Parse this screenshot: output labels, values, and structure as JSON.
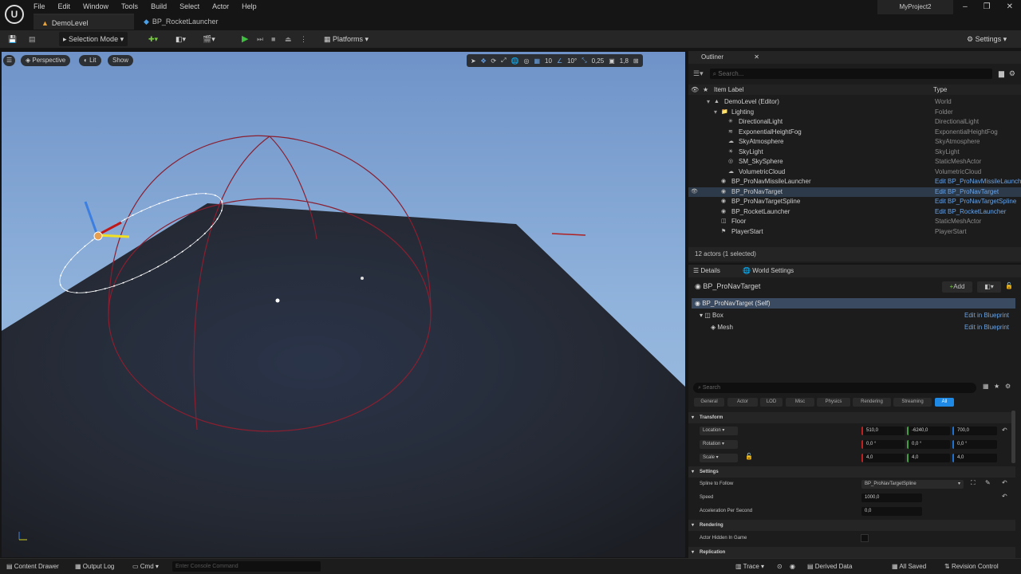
{
  "menu": [
    "File",
    "Edit",
    "Window",
    "Tools",
    "Build",
    "Select",
    "Actor",
    "Help"
  ],
  "tabs": [
    "DemoLevel",
    "BP_RocketLauncher"
  ],
  "project_name": "MyProject2",
  "toolbar": {
    "selection_mode": "Selection Mode",
    "platforms": "Platforms",
    "settings": "Settings"
  },
  "viewport": {
    "view_mode": "Perspective",
    "lit": "Lit",
    "show": "Show",
    "grid_snap": "10",
    "rot_snap": "10°",
    "scale_snap": "0,25",
    "cam_speed": "1,8"
  },
  "outliner": {
    "title": "Outliner",
    "search_placeholder": "Search...",
    "col_label": "Item Label",
    "col_type": "Type",
    "rows": [
      {
        "label": "DemoLevel (Editor)",
        "type": "World",
        "depth": 2,
        "link": false
      },
      {
        "label": "Lighting",
        "type": "Folder",
        "depth": 3,
        "link": false
      },
      {
        "label": "DirectionalLight",
        "type": "DirectionalLight",
        "depth": 4,
        "link": false
      },
      {
        "label": "ExponentialHeightFog",
        "type": "ExponentialHeightFog",
        "depth": 4,
        "link": false
      },
      {
        "label": "SkyAtmosphere",
        "type": "SkyAtmosphere",
        "depth": 4,
        "link": false
      },
      {
        "label": "SkyLight",
        "type": "SkyLight",
        "depth": 4,
        "link": false
      },
      {
        "label": "SM_SkySphere",
        "type": "StaticMeshActor",
        "depth": 4,
        "link": false
      },
      {
        "label": "VolumetricCloud",
        "type": "VolumetricCloud",
        "depth": 4,
        "link": false
      },
      {
        "label": "BP_ProNavMissileLauncher",
        "type": "Edit BP_ProNavMissileLauncher",
        "depth": 3,
        "link": true
      },
      {
        "label": "BP_ProNavTarget",
        "type": "Edit BP_ProNavTarget",
        "depth": 3,
        "link": true,
        "selected": true
      },
      {
        "label": "BP_ProNavTargetSpline",
        "type": "Edit BP_ProNavTargetSpline",
        "depth": 3,
        "link": true
      },
      {
        "label": "BP_RocketLauncher",
        "type": "Edit BP_RocketLauncher",
        "depth": 3,
        "link": true
      },
      {
        "label": "Floor",
        "type": "StaticMeshActor",
        "depth": 3,
        "link": false
      },
      {
        "label": "PlayerStart",
        "type": "PlayerStart",
        "depth": 3,
        "link": false
      }
    ],
    "footer": "12 actors (1 selected)"
  },
  "details": {
    "tab_details": "Details",
    "tab_world": "World Settings",
    "actor_name": "BP_ProNavTarget",
    "add_label": "Add",
    "self": "BP_ProNavTarget (Self)",
    "components": [
      {
        "name": "Box",
        "action": "Edit in Blueprint"
      },
      {
        "name": "Mesh",
        "action": "Edit in Blueprint"
      }
    ],
    "search_placeholder": "Search",
    "filters": [
      "General",
      "Actor",
      "LOD",
      "Misc",
      "Physics",
      "Rendering",
      "Streaming",
      "All"
    ],
    "transform": {
      "header": "Transform",
      "location_label": "Location",
      "rotation_label": "Rotation",
      "scale_label": "Scale",
      "location": [
        "510,0",
        "-6240,0",
        "700,0"
      ],
      "rotation": [
        "0,0 °",
        "0,0 °",
        "0,0 °"
      ],
      "scale": [
        "4,0",
        "4,0",
        "4,0"
      ]
    },
    "settings": {
      "header": "Settings",
      "spline_label": "Spline to Follow",
      "spline_value": "BP_ProNavTargetSpline",
      "speed_label": "Speed",
      "speed_value": "1000,0",
      "accel_label": "Acceleration Per Second",
      "accel_value": "0,0"
    },
    "rendering": {
      "header": "Rendering",
      "hidden_label": "Actor Hidden In Game"
    },
    "replication_header": "Replication"
  },
  "statusbar": {
    "content_drawer": "Content Drawer",
    "output_log": "Output Log",
    "cmd": "Cmd",
    "console_placeholder": "Enter Console Command",
    "trace": "Trace",
    "derived_data": "Derived Data",
    "all_saved": "All Saved",
    "revision_control": "Revision Control"
  },
  "colors": {
    "accent": "#1f8ae6",
    "selection": "#2d3a4a",
    "link": "#6aa3e5",
    "play": "#3fbf3f"
  }
}
